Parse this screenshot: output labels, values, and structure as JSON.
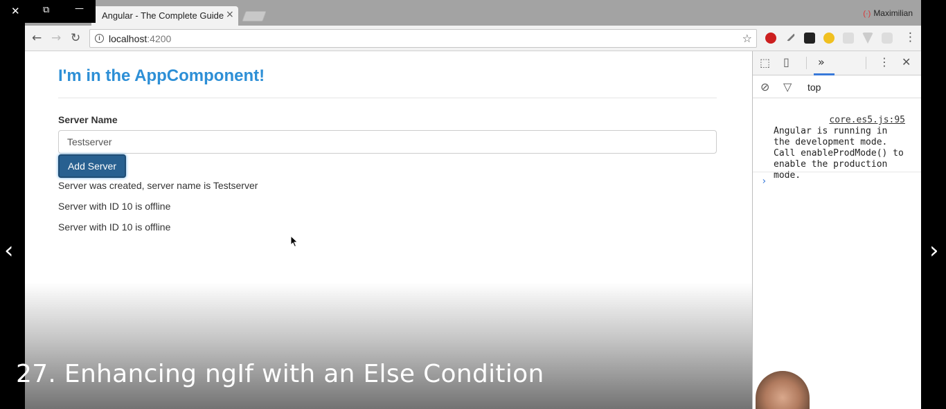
{
  "player": {
    "close_glyph": "✕",
    "restore_glyph": "⧉",
    "minimize_glyph": "—",
    "prev_glyph": "‹",
    "next_glyph": "›"
  },
  "browser": {
    "tab_title": "Angular - The Complete Guide",
    "tab_close_glyph": "×",
    "profile_name": "Maximilian",
    "url_host": "localhost",
    "url_port": ":4200"
  },
  "page": {
    "heading": "I'm in the AppComponent!",
    "server_name_label": "Server Name",
    "server_name_value": "Testserver",
    "add_server_label": "Add Server",
    "created_message": "Server was created, server name is Testserver",
    "servers": [
      "Server with ID 10 is offline",
      "Server with ID 10 is offline"
    ]
  },
  "devtools": {
    "context": "top",
    "console_message": "Angular is running in the development mode. Call enableProdMode() to enable the production mode.",
    "console_source": "core.es5.js:95"
  },
  "video": {
    "lecture_title": "27. Enhancing ngIf with an Else Condition"
  },
  "colors": {
    "heading": "#2d8fd6",
    "button": "#286090",
    "devtools_accent": "#3879d9"
  }
}
